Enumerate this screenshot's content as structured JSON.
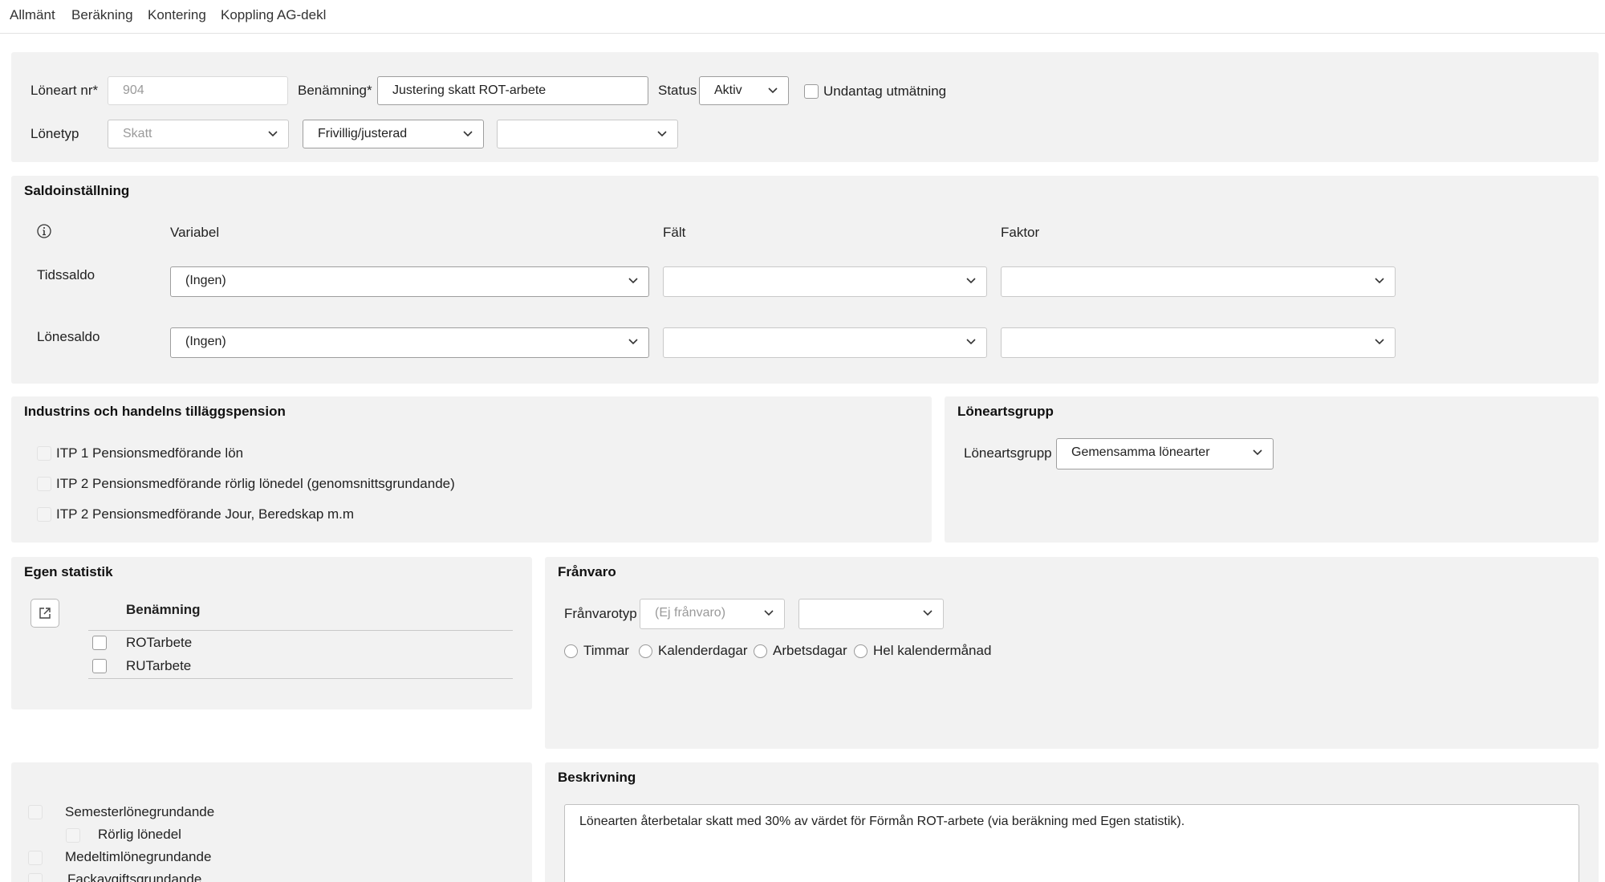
{
  "tabs": [
    "Allmänt",
    "Beräkning",
    "Kontering",
    "Koppling AG-dekl"
  ],
  "general": {
    "loneart_label": "Löneart nr*",
    "loneart_value": "904",
    "benamning_label": "Benämning*",
    "benamning_value": "Justering skatt ROT-arbete",
    "status_label": "Status",
    "status_value": "Aktiv",
    "undantag_label": "Undantag utmätning",
    "lonetyp_label": "Lönetyp",
    "lonetyp_value": "Skatt",
    "lonetyp_sub_value": "Frivillig/justerad",
    "lonetyp_extra_value": ""
  },
  "saldo": {
    "title": "Saldoinställning",
    "col_variabel": "Variabel",
    "col_falt": "Fält",
    "col_faktor": "Faktor",
    "rows": [
      {
        "label": "Tidssaldo",
        "variabel": "(Ingen)",
        "falt": "",
        "faktor": ""
      },
      {
        "label": "Lönesaldo",
        "variabel": "(Ingen)",
        "falt": "",
        "faktor": ""
      }
    ]
  },
  "pension": {
    "title": "Industrins och handelns tilläggspension",
    "items": [
      "ITP 1 Pensionsmedförande lön",
      "ITP 2 Pensionsmedförande rörlig lönedel (genomsnittsgrundande)",
      "ITP 2 Pensionsmedförande Jour, Beredskap m.m"
    ]
  },
  "loneartsgrupp": {
    "title": "Löneartsgrupp",
    "label": "Löneartsgrupp",
    "value": "Gemensamma lönearter"
  },
  "egen_statistik": {
    "title": "Egen statistik",
    "column": "Benämning",
    "rows": [
      "ROTarbete",
      "RUTarbete"
    ]
  },
  "franvaro": {
    "title": "Frånvaro",
    "label": "Frånvarotyp",
    "value": "(Ej frånvaro)",
    "extra_value": "",
    "options": [
      "Timmar",
      "Kalenderdagar",
      "Arbetsdagar",
      "Hel kalendermånad"
    ]
  },
  "grundande": {
    "items": [
      "Semesterlönegrundande",
      "Rörlig lönedel",
      "Medeltimlönegrundande",
      "Fackavgiftsgrundande"
    ]
  },
  "beskrivning": {
    "title": "Beskrivning",
    "text": "Lönearten återbetalar skatt med 30% av värdet för Förmån ROT-arbete (via beräkning med Egen statistik)."
  }
}
